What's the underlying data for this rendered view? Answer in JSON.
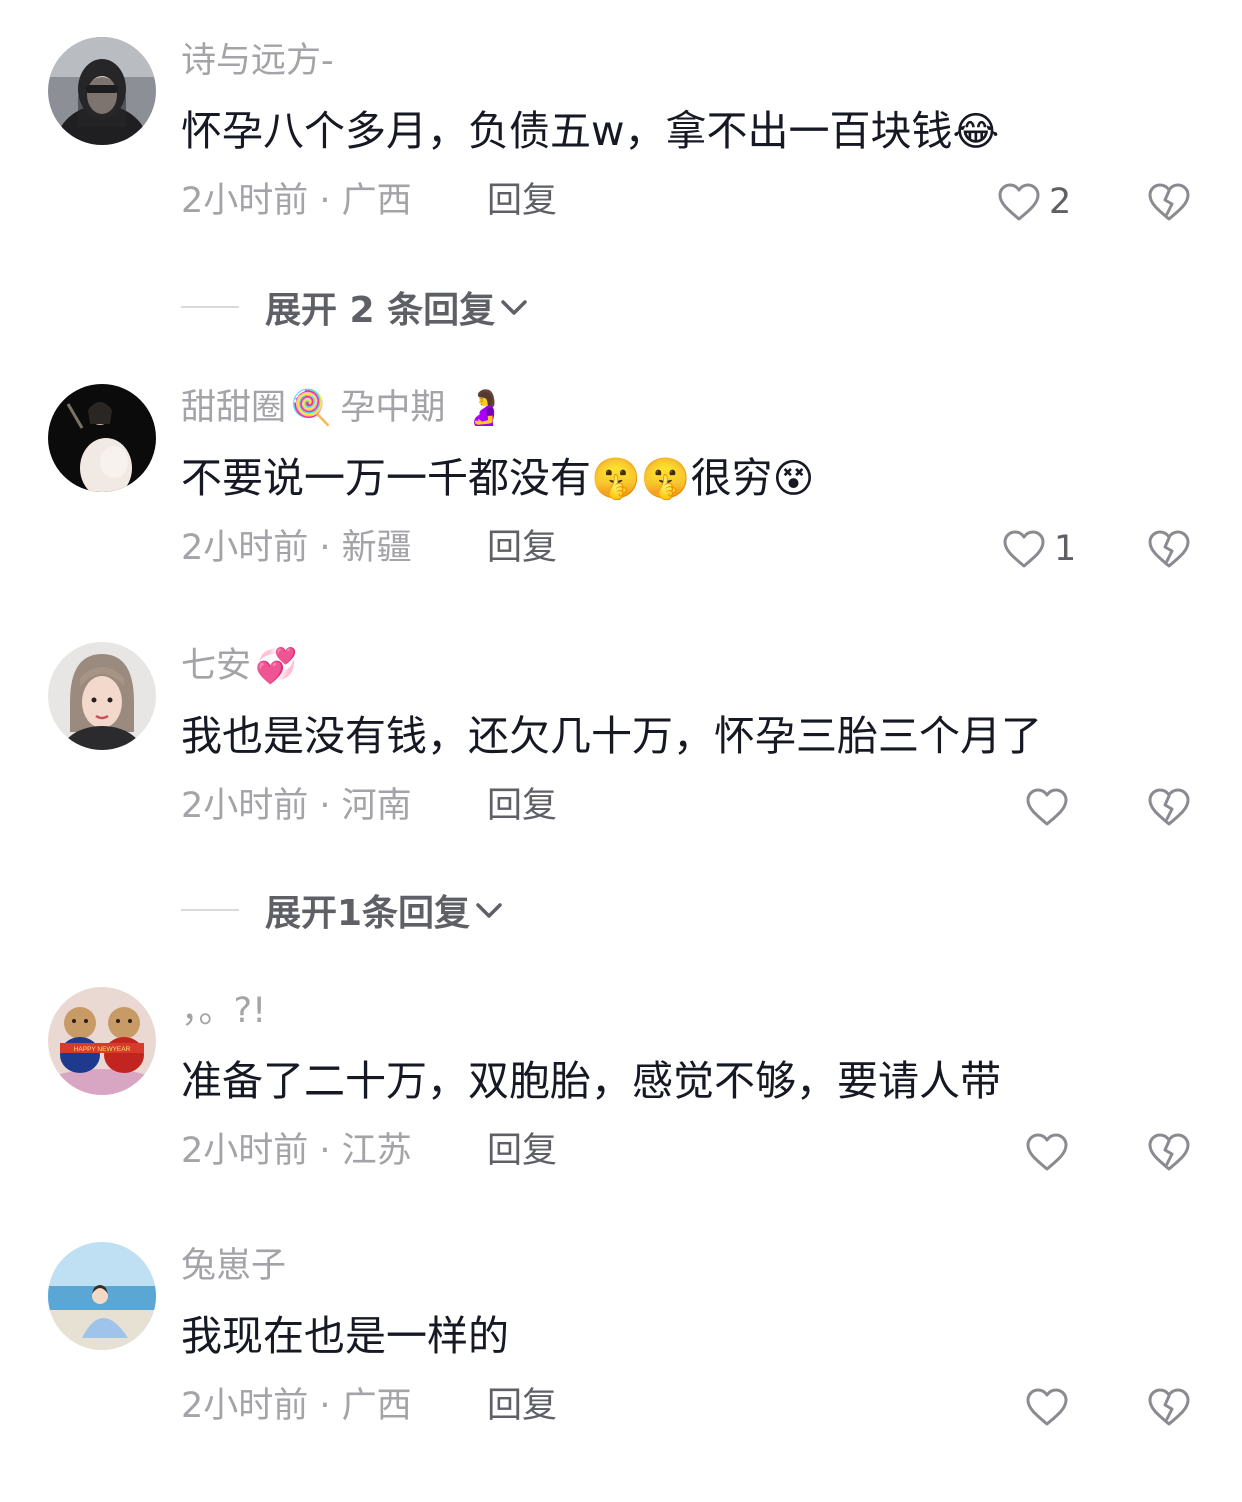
{
  "comments": [
    {
      "username": "诗与远方-",
      "badge_emoji": "",
      "tag": "",
      "tag_emoji": "",
      "text": "怀孕八个多月，负债五w，拿不出一百块钱",
      "text_emoji": "😂",
      "time_location": "2小时前 · 广西",
      "reply_label": "回复",
      "like_count": "2",
      "avatar_icon": "avatar-woman-sunglasses"
    },
    {
      "username": "甜甜圈",
      "badge_emoji": "🍭",
      "tag": "孕中期",
      "tag_emoji": "🤰",
      "text": "不要说一万一千都没有",
      "text_emoji_mid": "🤫🤫",
      "text_suffix": "很穷",
      "text_emoji": "😵",
      "time_location": "2小时前 · 新疆",
      "reply_label": "回复",
      "like_count": "1",
      "avatar_icon": "avatar-pregnant-woman"
    },
    {
      "username": "七安",
      "badge_emoji": "💞",
      "tag": "",
      "tag_emoji": "",
      "text": "我也是没有钱，还欠几十万，怀孕三胎三个月了",
      "text_emoji": "",
      "time_location": "2小时前 · 河南",
      "reply_label": "回复",
      "like_count": "",
      "avatar_icon": "avatar-woman-portrait"
    },
    {
      "username": "，。?!",
      "badge_emoji": "",
      "tag": "",
      "tag_emoji": "",
      "text": "准备了二十万，双胞胎，感觉不够，要请人带",
      "text_emoji": "",
      "time_location": "2小时前 · 江苏",
      "reply_label": "回复",
      "like_count": "",
      "avatar_icon": "avatar-teddy-bears",
      "avatar_text": "HAPPY NEWYEAR"
    },
    {
      "username": "兔崽子",
      "badge_emoji": "",
      "tag": "",
      "tag_emoji": "",
      "text": "我现在也是一样的",
      "text_emoji": "",
      "time_location": "2小时前 · 广西",
      "reply_label": "回复",
      "like_count": "",
      "avatar_icon": "avatar-beach-woman"
    }
  ],
  "expand_replies": [
    {
      "label": "展开 2 条回复"
    },
    {
      "label": "展开1条回复"
    }
  ]
}
